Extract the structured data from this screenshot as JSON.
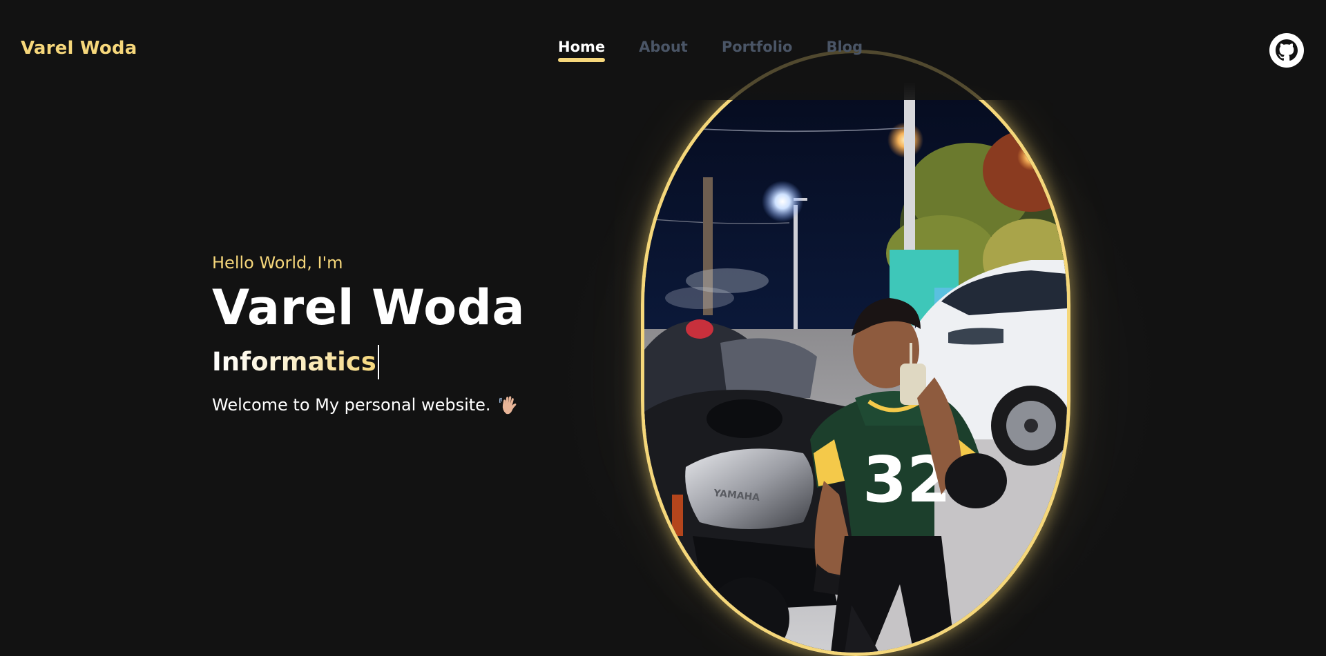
{
  "header": {
    "logo": "Varel Woda",
    "nav": [
      {
        "label": "Home",
        "active": true
      },
      {
        "label": "About",
        "active": false
      },
      {
        "label": "Portfolio",
        "active": false
      },
      {
        "label": "Blog",
        "active": false
      }
    ],
    "github_icon": "github-icon"
  },
  "hero": {
    "greeting": "Hello World, I'm",
    "name": "Varel Woda",
    "role": "Informatics",
    "welcome": "Welcome to My personal website.",
    "welcome_icon": "waving-hand-icon"
  },
  "colors": {
    "background": "#121212",
    "accent": "#f6d77b",
    "text": "#ffffff",
    "nav_inactive": "#4a5566"
  }
}
